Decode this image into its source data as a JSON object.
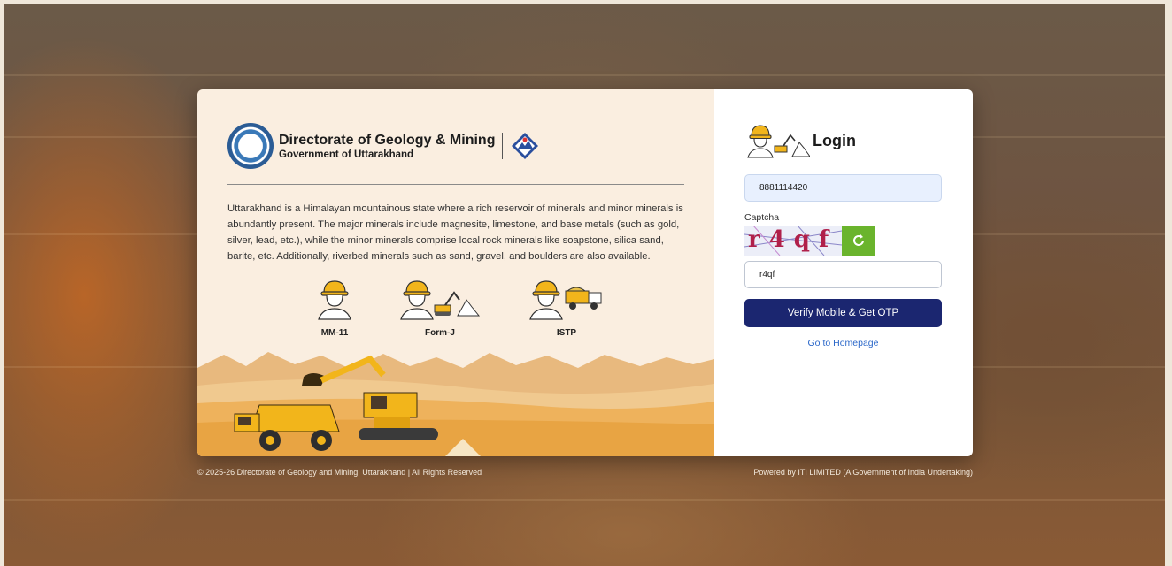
{
  "brand": {
    "title": "Directorate of Geology & Mining",
    "subtitle": "Government of Uttarakhand"
  },
  "description": "Uttarakhand is a Himalayan mountainous state where a rich reservoir of minerals and minor minerals is abundantly present. The major minerals include magnesite, limestone, and base metals (such as gold, silver, lead, etc.), while the minor minerals comprise local rock minerals like soapstone, silica sand, barite, etc. Additionally, riverbed minerals such as sand, gravel, and boulders are also available.",
  "roles": [
    {
      "label": "MM-11",
      "icon": "worker-icon"
    },
    {
      "label": "Form-J",
      "icon": "worker-excavator-icon"
    },
    {
      "label": "ISTP",
      "icon": "worker-truck-icon"
    }
  ],
  "login": {
    "title": "Login",
    "mobile_value": "8881114420",
    "captcha_label": "Captcha",
    "captcha_text": "r4qf",
    "captcha_input_value": "r4qf",
    "verify_button": "Verify Mobile & Get OTP",
    "home_link": "Go to Homepage"
  },
  "footer": {
    "copyright": "© 2025-26 Directorate of Geology and Mining, Uttarakhand | All Rights Reserved",
    "powered_by": "Powered by ITI LIMITED (A Government of India Undertaking)"
  },
  "colors": {
    "primary_button": "#1b2670",
    "refresh_button": "#6ab42d",
    "link": "#2a67c9",
    "left_panel_bg": "#faeee0"
  }
}
